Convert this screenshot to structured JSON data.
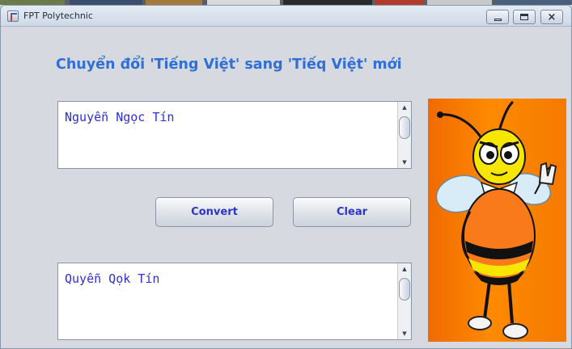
{
  "window": {
    "title": "FPT Polytechnic",
    "controls": {
      "minimize_icon": "minimize-icon",
      "maximize_icon": "maximize-icon",
      "close_icon": "close-icon",
      "close_glyph": "×"
    }
  },
  "heading": "Chuyển đổi 'Tiếng Việt' sang 'Tiếq Việt' mới",
  "input_text": "Nguyễn Ngọc Tín",
  "output_text": "Quyễn Qọk Tín",
  "buttons": {
    "convert": "Convert",
    "clear": "Clear"
  },
  "scroll_arrows": {
    "up": "▲",
    "down": "▼"
  },
  "colors": {
    "heading": "#2f6fd6",
    "button_text": "#2c35c8",
    "text_area_text": "#2e2fd4",
    "mascot_background": "#ff8a00"
  },
  "mascot": {
    "icon": "bee-mascot-image"
  }
}
